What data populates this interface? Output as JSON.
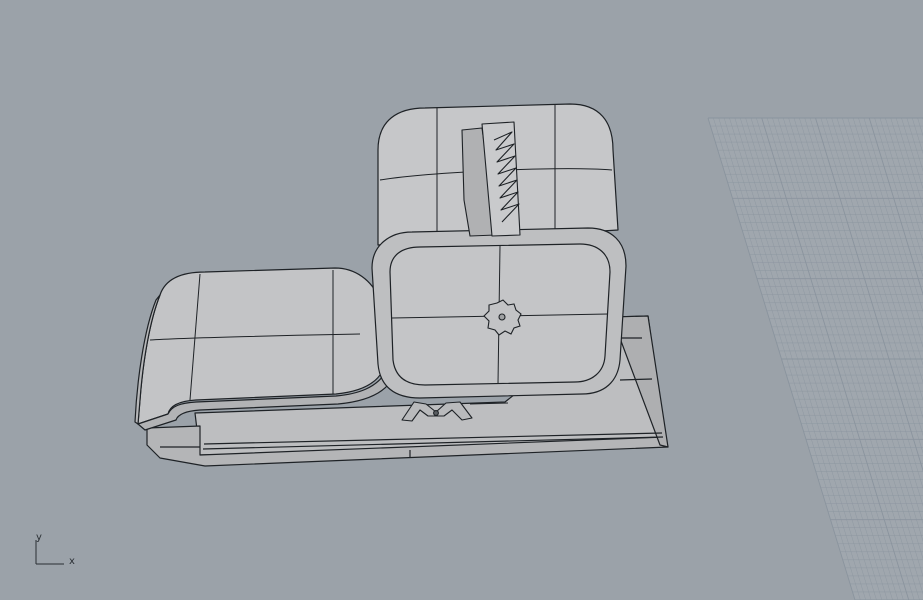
{
  "viewport": {
    "background": "#9ba2a9",
    "view": "perspective",
    "display_mode": "shaded",
    "object_color": "#bfc0c2",
    "edge_color": "#1e2226",
    "grid_color": "#8a949e",
    "grid_visible": true
  },
  "axis_widget": {
    "x_label": "x",
    "y_label": "y"
  }
}
